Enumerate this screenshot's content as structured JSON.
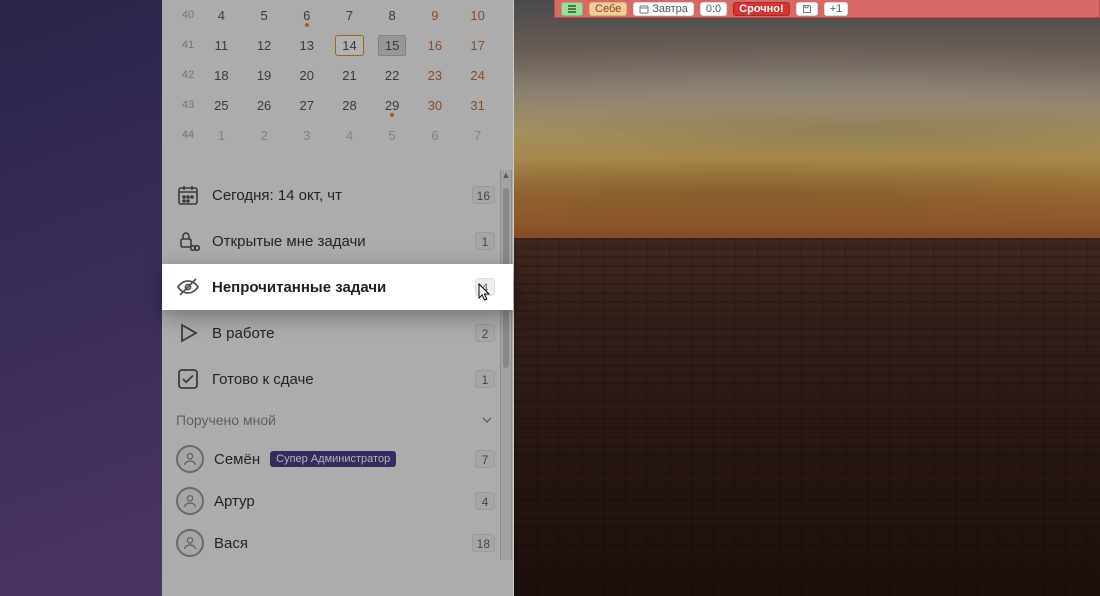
{
  "calendar": {
    "rows": [
      {
        "week": "40",
        "days": [
          {
            "n": "4"
          },
          {
            "n": "5"
          },
          {
            "n": "6",
            "dot": true
          },
          {
            "n": "7"
          },
          {
            "n": "8"
          },
          {
            "n": "9",
            "wkend": true
          },
          {
            "n": "10",
            "wkend": true
          }
        ]
      },
      {
        "week": "41",
        "days": [
          {
            "n": "11"
          },
          {
            "n": "12"
          },
          {
            "n": "13"
          },
          {
            "n": "14",
            "today": true
          },
          {
            "n": "15",
            "sel": true
          },
          {
            "n": "16",
            "wkend": true
          },
          {
            "n": "17",
            "wkend": true
          }
        ]
      },
      {
        "week": "42",
        "days": [
          {
            "n": "18"
          },
          {
            "n": "19"
          },
          {
            "n": "20"
          },
          {
            "n": "21"
          },
          {
            "n": "22"
          },
          {
            "n": "23",
            "wkend": true
          },
          {
            "n": "24",
            "wkend": true
          }
        ]
      },
      {
        "week": "43",
        "days": [
          {
            "n": "25"
          },
          {
            "n": "26"
          },
          {
            "n": "27"
          },
          {
            "n": "28"
          },
          {
            "n": "29",
            "dot": true
          },
          {
            "n": "30",
            "wkend": true
          },
          {
            "n": "31",
            "wkend": true
          }
        ]
      },
      {
        "week": "44",
        "days": [
          {
            "n": "1",
            "other": true
          },
          {
            "n": "2",
            "other": true
          },
          {
            "n": "3",
            "other": true
          },
          {
            "n": "4",
            "other": true
          },
          {
            "n": "5",
            "other": true
          },
          {
            "n": "6",
            "other": true,
            "wkend": true
          },
          {
            "n": "7",
            "other": true,
            "wkend": true
          }
        ]
      }
    ]
  },
  "filters": {
    "today": {
      "label": "Сегодня: 14 окт, чт",
      "count": "16"
    },
    "open": {
      "label": "Открытые мне задачи",
      "count": "1"
    },
    "unread": {
      "label": "Непрочитанные задачи",
      "count": "4"
    },
    "working": {
      "label": "В работе",
      "count": "2"
    },
    "ready": {
      "label": "Готово к сдаче",
      "count": "1"
    }
  },
  "assigned_by_me": {
    "title": "Поручено мной",
    "people": [
      {
        "name": "Семён",
        "tag": "Супер Администратор",
        "count": "7"
      },
      {
        "name": "Артур",
        "count": "4"
      },
      {
        "name": "Вася",
        "count": "18"
      }
    ]
  },
  "toolbar": {
    "items": [
      {
        "name": "checklist",
        "kind": "icon"
      },
      {
        "name": "self-chip",
        "kind": "amber",
        "label": "Себе"
      },
      {
        "name": "tomorrow",
        "kind": "calendar",
        "label": "Завтра"
      },
      {
        "name": "time",
        "kind": "chip",
        "label": "0:0"
      },
      {
        "name": "urgent",
        "kind": "solid-red",
        "label": "Срочно!"
      },
      {
        "name": "save",
        "kind": "icon-save"
      },
      {
        "name": "plusone",
        "kind": "chip",
        "label": "+1"
      }
    ]
  },
  "colors": {
    "accent_orange": "#e0941a",
    "urgent_red": "#d43530",
    "tag_purple": "#4b3f8c"
  }
}
